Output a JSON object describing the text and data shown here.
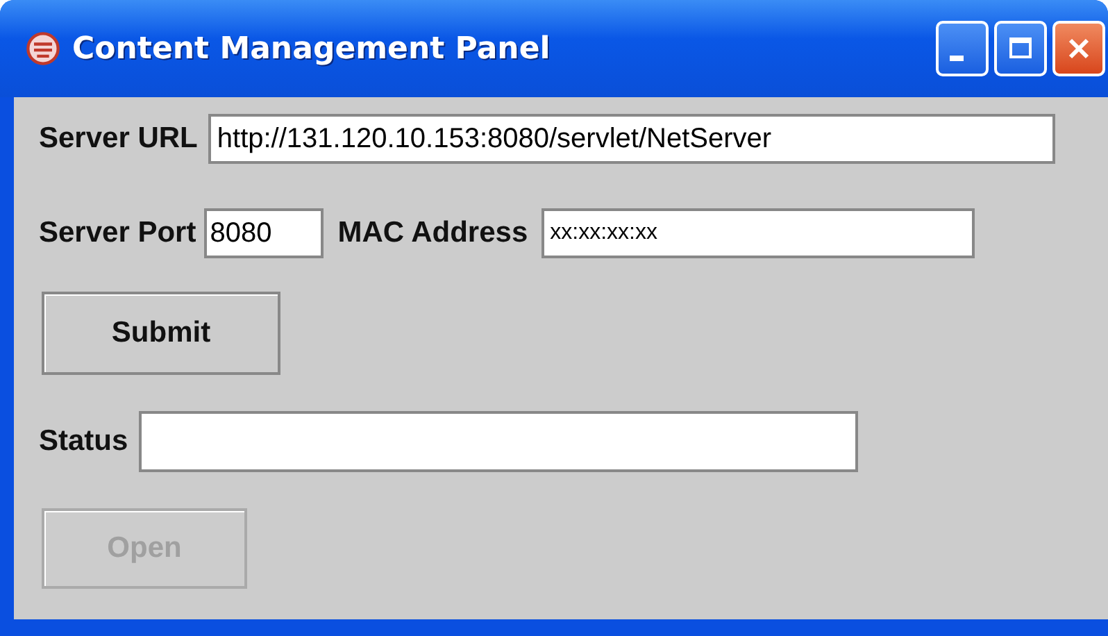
{
  "window": {
    "title": "Content Management Panel"
  },
  "fields": [
    {
      "label": "Server URL",
      "value": "http://131.120.10.153:8080/servlet/NetServer"
    },
    {
      "label": "Server Port",
      "value": "8080"
    },
    {
      "label": "MAC Address",
      "value": "xx:xx:xx:xx"
    },
    {
      "label": "Status"
    }
  ],
  "buttons": [
    {
      "label": "Submit",
      "disabled": false
    },
    {
      "label": "Open",
      "disabled": true
    }
  ]
}
